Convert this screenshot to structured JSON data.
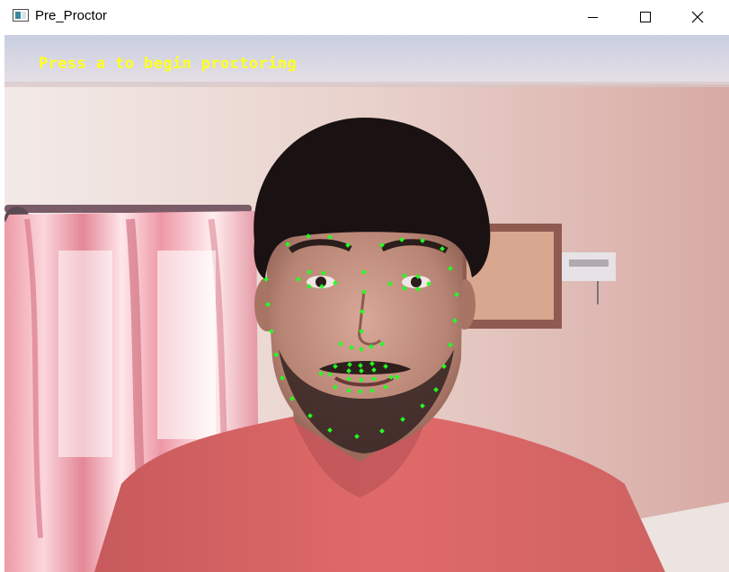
{
  "window": {
    "title": "Pre_Proctor",
    "controls": {
      "minimize_icon": "minimize-icon",
      "maximize_icon": "maximize-icon",
      "close_icon": "close-icon"
    }
  },
  "camera_feed": {
    "overlay_text": "Press a to begin proctoring",
    "overlay_color": "#ffff1e",
    "landmark_color": "#22ff22",
    "landmark_count": 68
  }
}
